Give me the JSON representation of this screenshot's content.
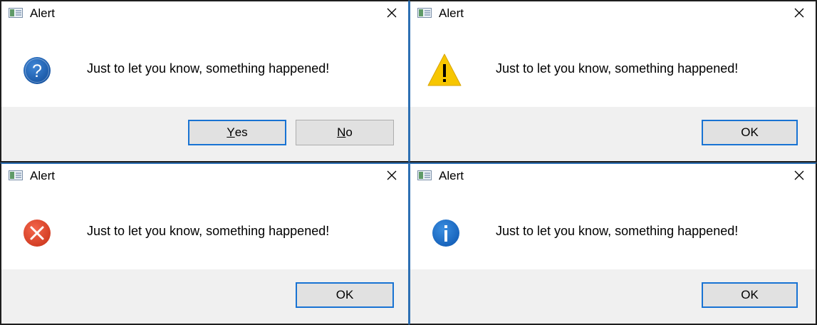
{
  "dialogs": [
    {
      "title": "Alert",
      "icon": "question-icon",
      "message": "Just to let you know, something happened!",
      "buttons": [
        {
          "label_first": "Y",
          "label_rest": "es"
        },
        {
          "label_first": "N",
          "label_rest": "o"
        }
      ]
    },
    {
      "title": "Alert",
      "icon": "warning-icon",
      "message": "Just to let you know, something happened!",
      "buttons": [
        {
          "label": "OK"
        }
      ]
    },
    {
      "title": "Alert",
      "icon": "error-icon",
      "message": "Just to let you know, something happened!",
      "buttons": [
        {
          "label": "OK"
        }
      ]
    },
    {
      "title": "Alert",
      "icon": "information-icon",
      "message": "Just to let you know, something happened!",
      "buttons": [
        {
          "label": "OK"
        }
      ]
    }
  ],
  "colors": {
    "accent_border": "#1873d3",
    "question_blue": "#1f63b5",
    "warning_yellow": "#f7c600",
    "error_red": "#e6452b",
    "info_blue": "#1a73d0",
    "footer_gray": "#f0f0f0"
  }
}
